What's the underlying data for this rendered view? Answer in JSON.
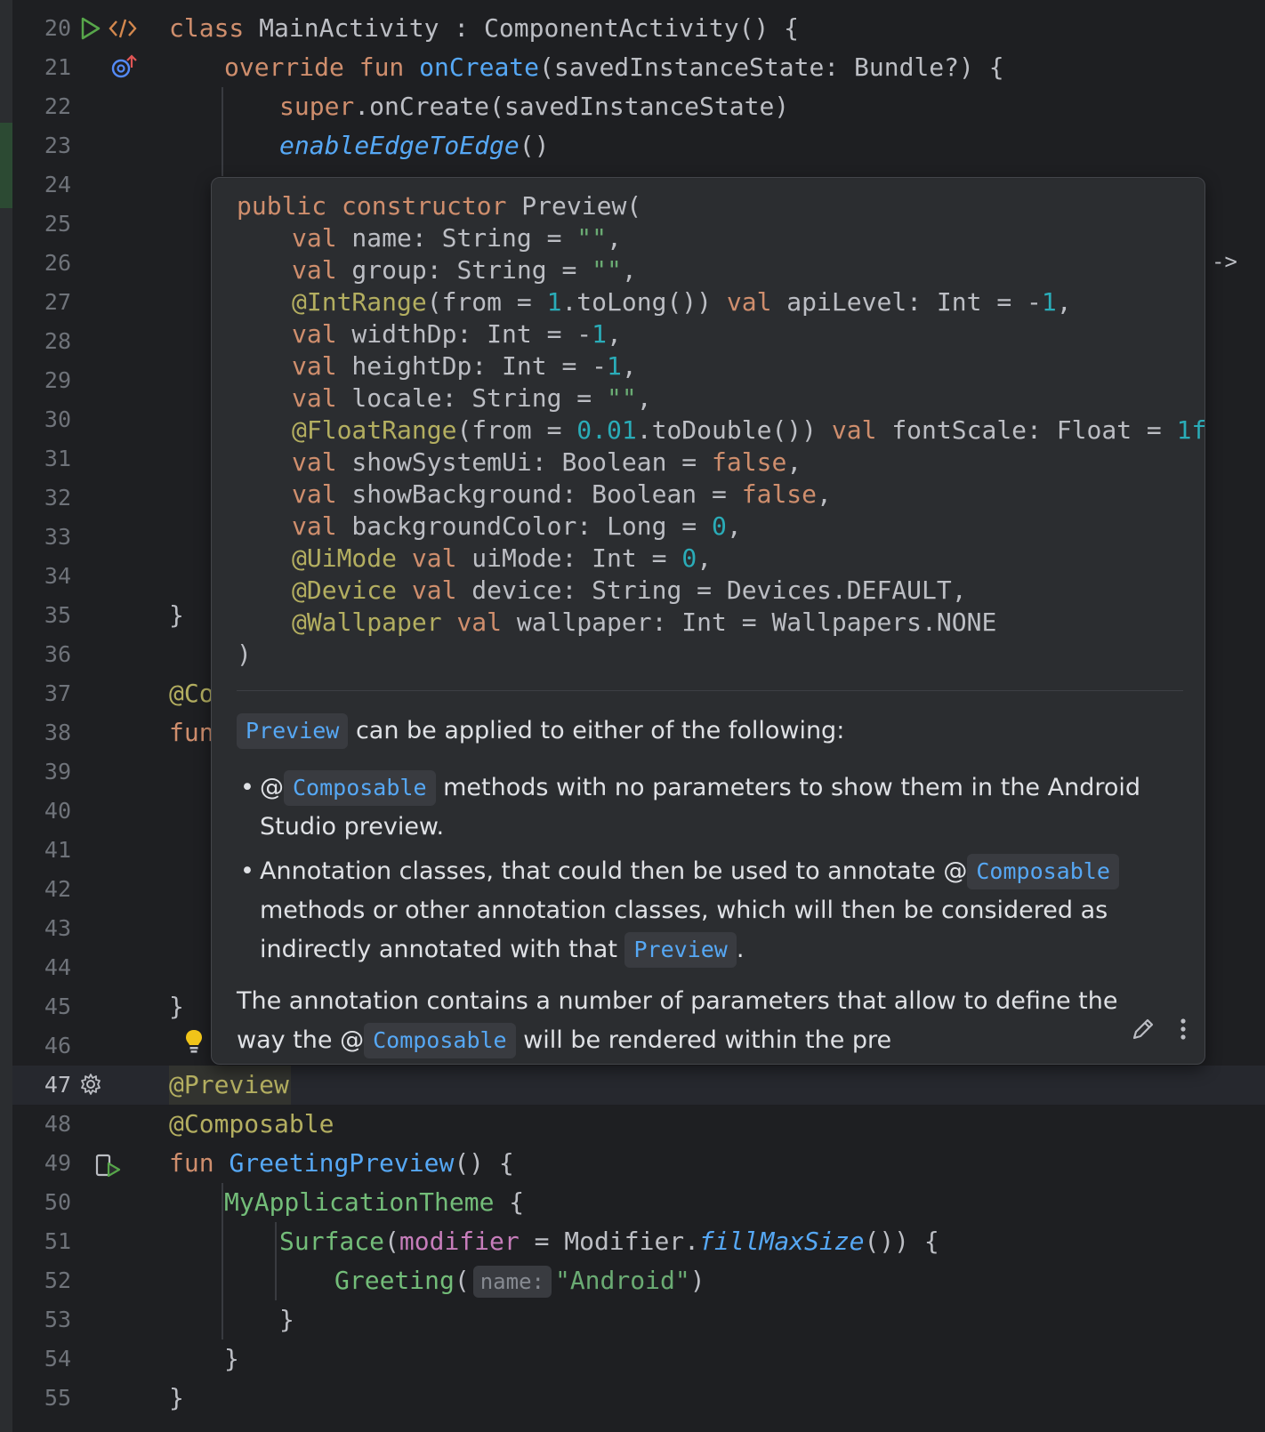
{
  "editor": {
    "line_numbers": [
      "20",
      "21",
      "22",
      "23",
      "24",
      "25",
      "26",
      "27",
      "28",
      "29",
      "30",
      "31",
      "32",
      "33",
      "34",
      "35",
      "36",
      "37",
      "38",
      "39",
      "40",
      "41",
      "42",
      "43",
      "44",
      "45",
      "46",
      "47",
      "48",
      "49",
      "50",
      "51",
      "52",
      "53",
      "54",
      "55"
    ],
    "current_line": "47",
    "code": {
      "l20": {
        "kw": "class",
        "name": "MainActivity",
        "sep": " : ",
        "parent": "ComponentActivity() {"
      },
      "l21": {
        "kw": "override fun",
        "fn": "onCreate",
        "rest": "(savedInstanceState: Bundle?) {"
      },
      "l22": {
        "kw": "super",
        "rest": ".onCreate(savedInstanceState)"
      },
      "l23": {
        "fn": "enableEdgeToEdge",
        "rest": "()"
      },
      "l35": "}",
      "l37": "@Co",
      "l38": "fun",
      "l45": "}",
      "l47": "@Preview",
      "l48": "@Composable",
      "l49": {
        "kw": "fun",
        "fn": "GreetingPreview",
        "rest": "() {"
      },
      "l50": {
        "fn": "MyApplicationTheme",
        "rest": " {"
      },
      "l51": {
        "fn": "Surface",
        "open": "(",
        "param": "modifier",
        "mid": " = Modifier.",
        "ital": "fillMaxSize",
        "rest": "()) {"
      },
      "l52": {
        "fn": "Greeting",
        "open": "(",
        "hint": "name:",
        "str": "\"Android\"",
        "rest": ")"
      },
      "l53": "}",
      "l54": "}",
      "l55": "}"
    },
    "arrow_hint": "->"
  },
  "popup": {
    "signature": {
      "l1": {
        "kw": "public constructor",
        "name": "Preview("
      },
      "name": {
        "kw": "val",
        "rest": " name: String = ",
        "str": "\"\"",
        "end": ","
      },
      "group": {
        "kw": "val",
        "rest": " group: String = ",
        "str": "\"\"",
        "end": ","
      },
      "api": {
        "ann": "@IntRange",
        "a": "(from = ",
        "num": "1",
        "b": ".toLong()) ",
        "kw": "val",
        "c": " apiLevel: Int = -",
        "num2": "1",
        "end": ","
      },
      "width": {
        "kw": "val",
        "rest": " widthDp: Int = -",
        "num": "1",
        "end": ","
      },
      "height": {
        "kw": "val",
        "rest": " heightDp: Int = -",
        "num": "1",
        "end": ","
      },
      "locale": {
        "kw": "val",
        "rest": " locale: String = ",
        "str": "\"\"",
        "end": ","
      },
      "font": {
        "ann": "@FloatRange",
        "a": "(from = ",
        "num": "0.01",
        "b": ".toDouble()) ",
        "kw": "val",
        "c": " fontScale: Float = ",
        "num2": "1f",
        "end": ","
      },
      "sysui": {
        "kw": "val",
        "rest": " showSystemUi: Boolean = ",
        "kw2": "false",
        "end": ","
      },
      "bg": {
        "kw": "val",
        "rest": " showBackground: Boolean = ",
        "kw2": "false",
        "end": ","
      },
      "bgcolor": {
        "kw": "val",
        "rest": " backgroundColor: Long = ",
        "num": "0",
        "end": ","
      },
      "uimode": {
        "ann": "@UiMode",
        "kw": " val",
        "rest": " uiMode: Int = ",
        "num": "0",
        "end": ","
      },
      "device": {
        "ann": "@Device",
        "kw": " val",
        "rest": " device: String = Devices.DEFAULT,"
      },
      "wallpaper": {
        "ann": "@Wallpaper",
        "kw": " val",
        "rest": " wallpaper: Int = Wallpapers.NONE"
      },
      "close": ")"
    },
    "doc": {
      "p1_chip": "Preview",
      "p1_text": " can be applied to either of the following:",
      "b1_at": "@",
      "b1_chip": "Composable",
      "b1_text": " methods with no parameters to show them in the Android Studio preview.",
      "b2_text1": "Annotation classes, that could then be used to annotate ",
      "b2_at": "@",
      "b2_chip": "Composable",
      "b2_text2": " methods or other annotation classes, which will then be considered as indirectly annotated with that ",
      "b2_chip2": "Preview",
      "b2_end": ".",
      "p2_text1": "The annotation contains a number of parameters that allow to define the way the ",
      "p2_at": "@",
      "p2_chip": "Composable",
      "p2_text2": " will be rendered within the pre"
    }
  },
  "icons": {
    "run_gutter": "run-icon",
    "code_gutter": "code-icon",
    "override_gutter": "override-icon",
    "settings_gutter": "gear-icon",
    "preview_run_gutter": "preview-run-icon",
    "edit": "pencil-icon",
    "more": "more-vertical-icon",
    "intention": "lightbulb-icon"
  }
}
